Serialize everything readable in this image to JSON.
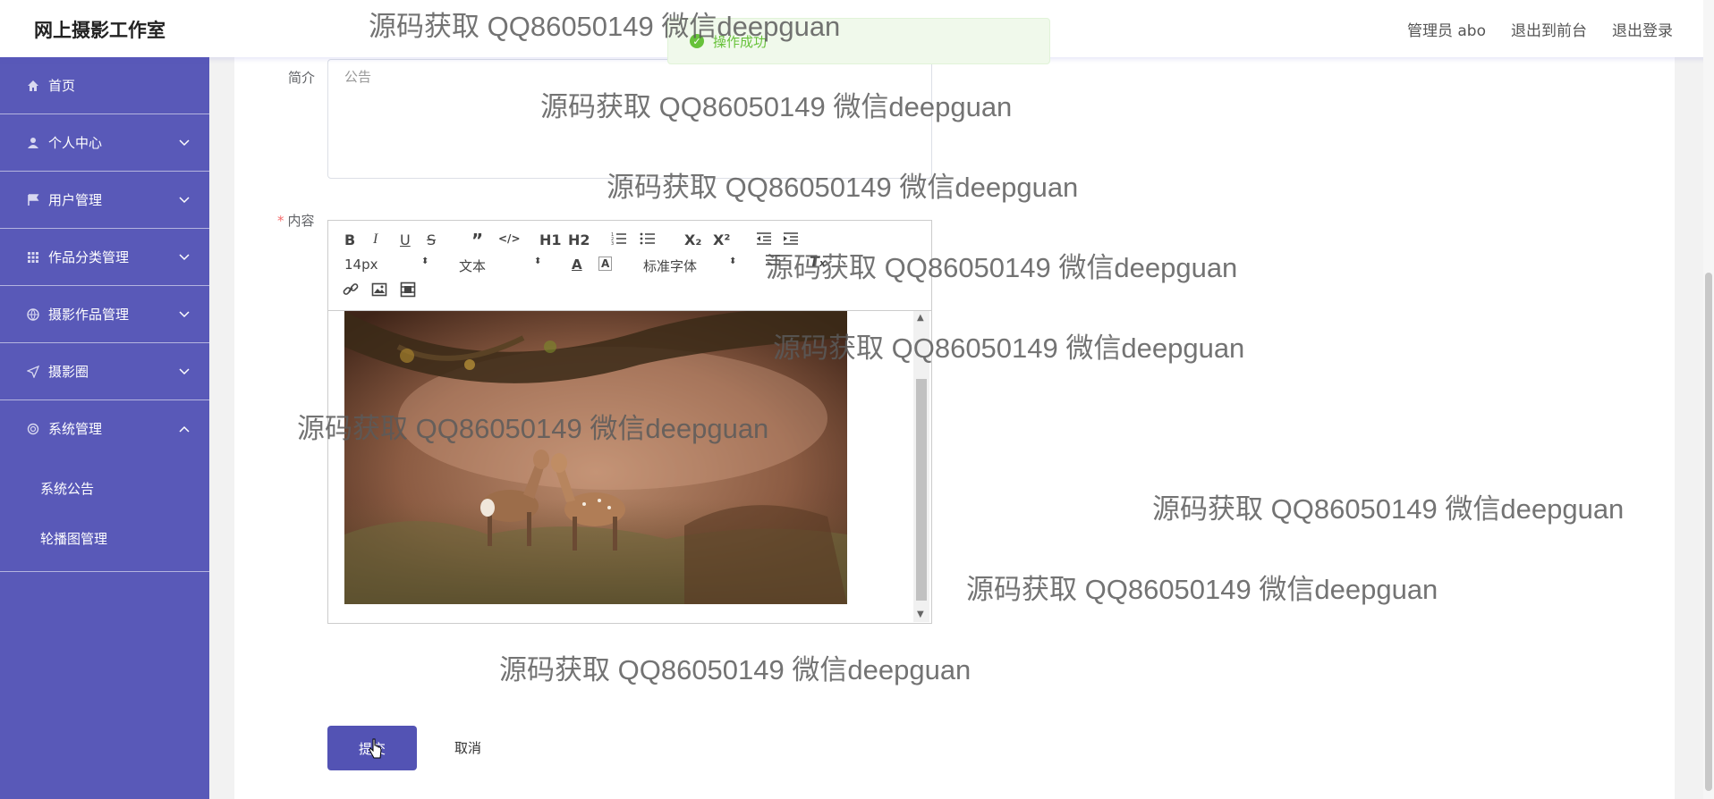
{
  "header": {
    "brand": "网上摄影工作室",
    "admin": "管理员 abo",
    "to_front": "退出到前台",
    "logout": "退出登录"
  },
  "toast": {
    "message": "操作成功",
    "icon": "check-circle-icon",
    "color": "#67c23a"
  },
  "sidebar": {
    "background": "#5959b8",
    "items": [
      {
        "label": "首页",
        "icon": "home-icon"
      },
      {
        "label": "个人中心",
        "icon": "user-icon"
      },
      {
        "label": "用户管理",
        "icon": "flag-icon"
      },
      {
        "label": "作品分类管理",
        "icon": "grid-icon"
      },
      {
        "label": "摄影作品管理",
        "icon": "globe-icon"
      },
      {
        "label": "摄影圈",
        "icon": "send-icon"
      },
      {
        "label": "系统管理",
        "icon": "settings-icon"
      }
    ],
    "submenu": [
      "系统公告",
      "轮播图管理"
    ]
  },
  "form": {
    "intro_label": "简介",
    "intro_placeholder": "公告",
    "content_label": "内容",
    "required_mark": "*",
    "submit": "提交",
    "cancel": "取消"
  },
  "editor": {
    "font_size": "14px",
    "header_select": "文本",
    "font_family": "标准字体",
    "tools": [
      "B",
      "I",
      "U",
      "S",
      "”",
      "</>",
      "H1",
      "H2",
      "ordered-list",
      "bullet-list",
      "X₂",
      "X²",
      "outdent",
      "indent",
      "A",
      "A",
      "clear-format",
      "link",
      "image",
      "video"
    ]
  },
  "watermark": "源码获取 QQ86050149 微信deepguan"
}
